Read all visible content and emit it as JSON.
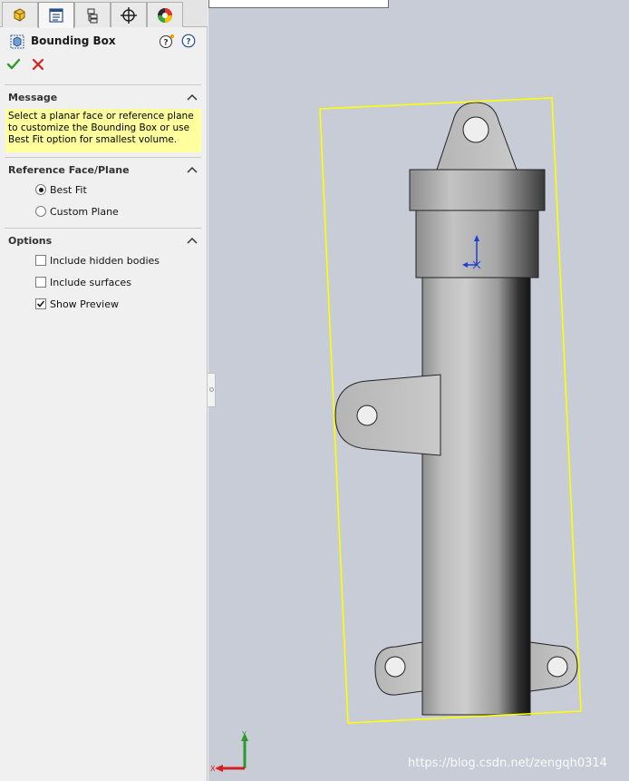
{
  "tabs": [
    {
      "name": "feature-manager",
      "icon": "part-icon",
      "active": false
    },
    {
      "name": "property-manager",
      "icon": "property-manager-icon",
      "active": true
    },
    {
      "name": "configuration-manager",
      "icon": "configuration-icon",
      "active": false
    },
    {
      "name": "dimxpert-manager",
      "icon": "crosshair-icon",
      "active": false
    },
    {
      "name": "display-manager",
      "icon": "appearance-icon",
      "active": false
    }
  ],
  "feature": {
    "title": "Bounding Box",
    "icon": "bounding-box-icon"
  },
  "actions": {
    "ok_icon": "checkmark-icon",
    "cancel_icon": "close-icon"
  },
  "sections": {
    "message": {
      "heading": "Message",
      "text": "Select a planar face or reference plane to customize the Bounding Box or use Best Fit option for smallest volume."
    },
    "reference": {
      "heading": "Reference Face/Plane",
      "options": [
        {
          "label": "Best Fit",
          "selected": true
        },
        {
          "label": "Custom Plane",
          "selected": false
        }
      ]
    },
    "options": {
      "heading": "Options",
      "checkboxes": [
        {
          "label": "Include hidden bodies",
          "checked": false
        },
        {
          "label": "Include surfaces",
          "checked": false
        },
        {
          "label": "Show Preview",
          "checked": true
        }
      ]
    }
  },
  "viewport": {
    "background": "#c7ccd6",
    "bounding_box_color": "#ffff00",
    "triad_labels": {
      "x": "X",
      "y": "Y"
    }
  },
  "watermark": "https://blog.csdn.net/zengqh0314"
}
